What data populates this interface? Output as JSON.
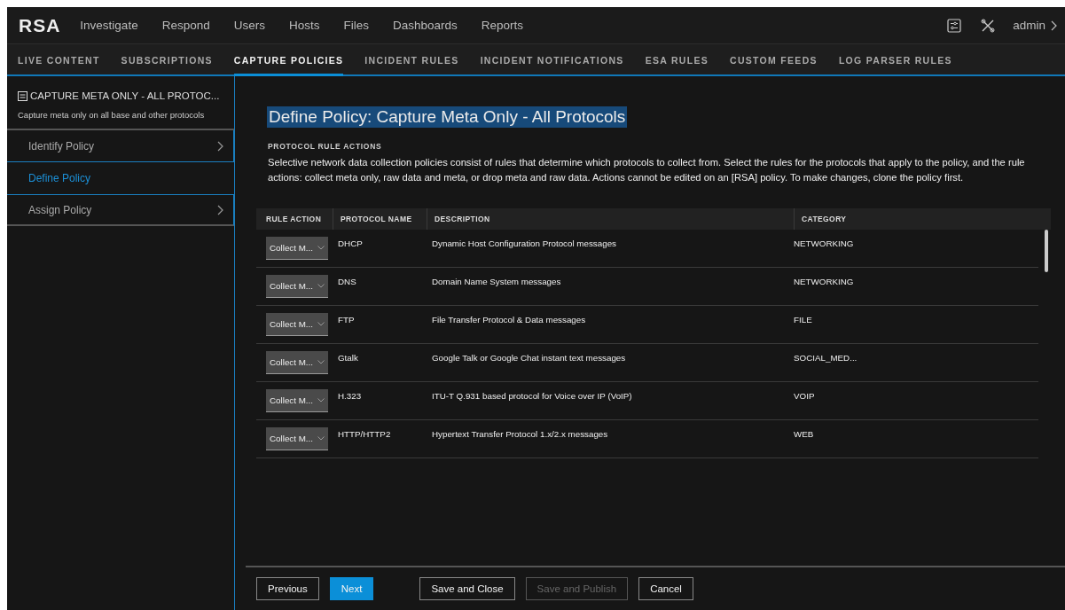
{
  "top_nav": {
    "logo": "RSA",
    "items": [
      "Investigate",
      "Respond",
      "Users",
      "Hosts",
      "Files",
      "Dashboards",
      "Reports"
    ],
    "user": "admin"
  },
  "sub_nav": [
    {
      "label": "LIVE CONTENT",
      "selected": false
    },
    {
      "label": "SUBSCRIPTIONS",
      "selected": false
    },
    {
      "label": "CAPTURE POLICIES",
      "selected": true
    },
    {
      "label": "INCIDENT RULES",
      "selected": false
    },
    {
      "label": "INCIDENT NOTIFICATIONS",
      "selected": false
    },
    {
      "label": "ESA RULES",
      "selected": false
    },
    {
      "label": "CUSTOM FEEDS",
      "selected": false
    },
    {
      "label": "LOG PARSER RULES",
      "selected": false
    }
  ],
  "sidebar": {
    "title": "CAPTURE META ONLY - ALL PROTOC...",
    "subtitle": "Capture meta only on all base and other protocols",
    "steps": [
      {
        "label": "Identify Policy",
        "selected": false
      },
      {
        "label": "Define Policy",
        "selected": true
      },
      {
        "label": "Assign Policy",
        "selected": false
      }
    ]
  },
  "main": {
    "title": "Define Policy: Capture Meta Only - All Protocols",
    "section_label": "PROTOCOL RULE ACTIONS",
    "description": "Selective network data collection policies consist of rules that determine which protocols to collect from. Select the rules for the protocols that apply to the policy, and the rule actions: collect meta only, raw data and meta, or drop meta and raw data. Actions cannot be edited on an [RSA] policy. To make changes, clone the policy first."
  },
  "table": {
    "columns": [
      "RULE ACTION",
      "PROTOCOL NAME",
      "DESCRIPTION",
      "CATEGORY"
    ],
    "rows": [
      {
        "action": "Collect M...",
        "protocol": "DHCP",
        "description": "Dynamic Host Configuration Protocol messages",
        "category": "NETWORKING"
      },
      {
        "action": "Collect M...",
        "protocol": "DNS",
        "description": "Domain Name System messages",
        "category": "NETWORKING"
      },
      {
        "action": "Collect M...",
        "protocol": "FTP",
        "description": "File Transfer Protocol & Data messages",
        "category": "FILE"
      },
      {
        "action": "Collect M...",
        "protocol": "Gtalk",
        "description": "Google Talk or Google Chat instant text messages",
        "category": "SOCIAL_MED..."
      },
      {
        "action": "Collect M...",
        "protocol": "H.323",
        "description": "ITU-T Q.931 based protocol for Voice over IP (VoIP)",
        "category": "VOIP"
      },
      {
        "action": "Collect M...",
        "protocol": "HTTP/HTTP2",
        "description": "Hypertext Transfer Protocol 1.x/2.x messages",
        "category": "WEB"
      }
    ]
  },
  "footer": {
    "buttons": [
      {
        "label": "Previous",
        "kind": "default",
        "disabled": false
      },
      {
        "label": "Next",
        "kind": "primary",
        "disabled": false
      },
      {
        "label": "Save and Close",
        "kind": "default",
        "disabled": false
      },
      {
        "label": "Save and Publish",
        "kind": "default",
        "disabled": true
      },
      {
        "label": "Cancel",
        "kind": "default",
        "disabled": false
      }
    ]
  }
}
